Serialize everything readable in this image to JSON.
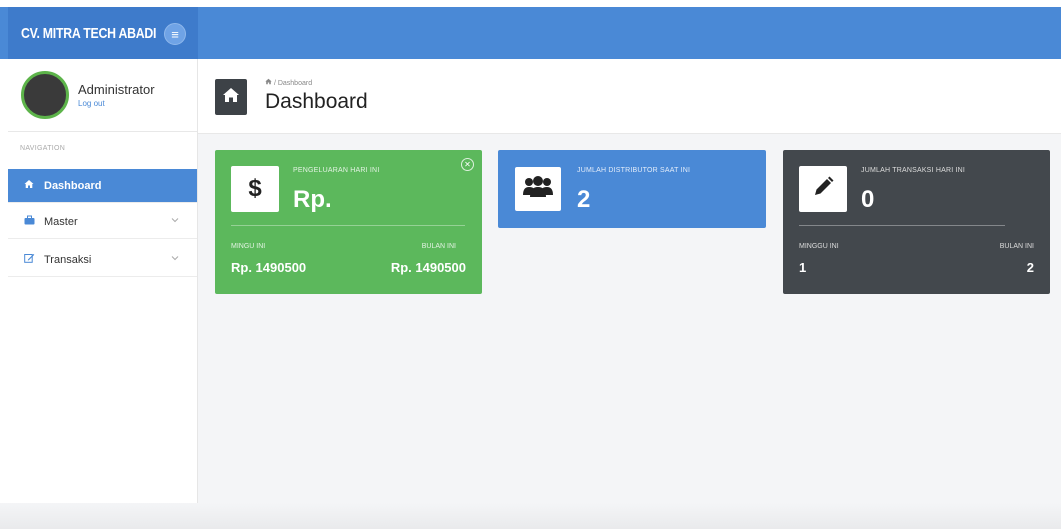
{
  "brand": {
    "name": "CV. MITRA TECH ABADI",
    "toggle_icon": "≡"
  },
  "user": {
    "name": "Administrator",
    "logout_label": "Log out"
  },
  "nav": {
    "heading": "NAVIGATION",
    "items": [
      {
        "label": "Dashboard",
        "icon": "home-icon",
        "active": true
      },
      {
        "label": "Master",
        "icon": "briefcase-icon",
        "active": false
      },
      {
        "label": "Transaksi",
        "icon": "edit-icon",
        "active": false
      }
    ]
  },
  "page": {
    "breadcrumb": "Dashboard",
    "title": "Dashboard"
  },
  "cards": {
    "pengeluaran": {
      "title": "PENGELUARAN HARI INI",
      "value": "Rp.",
      "sub_left_label": "MINGU INI",
      "sub_left_value": "Rp. 1490500",
      "sub_right_label": "BULAN INI",
      "sub_right_value": "Rp. 1490500",
      "color": "#5cb85c"
    },
    "distributor": {
      "title": "JUMLAH DISTRIBUTOR SAAT INI",
      "value": "2",
      "color": "#4a89d6"
    },
    "transaksi": {
      "title": "JUMLAH TRANSAKSI HARI INI",
      "value": "0",
      "sub_left_label": "MINGGU INI",
      "sub_left_value": "1",
      "sub_right_label": "BULAN INI",
      "sub_right_value": "2",
      "color": "#43484d"
    }
  },
  "colors": {
    "primary": "#4a89d6",
    "success": "#5cb85c",
    "dark": "#43484d"
  }
}
